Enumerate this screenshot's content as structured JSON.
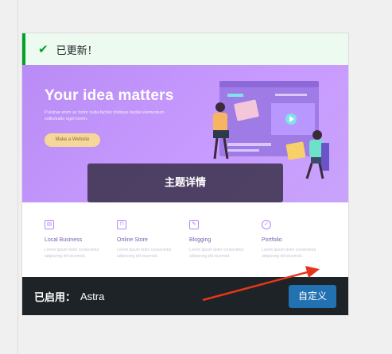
{
  "notice": {
    "icon": "checkmark-icon",
    "message": "已更新！",
    "accent": "#00a32a"
  },
  "theme_preview": {
    "hero_title": "Your idea matters",
    "hero_text": "Pulvinar enim ac tortor nulla facilisi tristique facilisi elementum sollicitudin eget lorem.",
    "hero_button": "Make a Website",
    "features": [
      {
        "icon": "building-icon",
        "title": "Local Business",
        "desc": "Lorem ipsum dolor consectetur adipiscing elit eiusmod."
      },
      {
        "icon": "bag-icon",
        "title": "Online Store",
        "desc": "Lorem ipsum dolor consectetur adipiscing elit eiusmod."
      },
      {
        "icon": "pencil-icon",
        "title": "Blogging",
        "desc": "Lorem ipsum dolor consectetur adipiscing elit eiusmod."
      },
      {
        "icon": "badge-icon",
        "title": "Portfolio",
        "desc": "Lorem ipsum dolor consectetur adipiscing elit eiusmod."
      }
    ]
  },
  "overlay": {
    "details_label": "主题详情"
  },
  "footer": {
    "active_label": "已启用：",
    "theme_name": "Astra",
    "customize_label": "自定义"
  },
  "colors": {
    "footer_bg": "#1d2327",
    "primary": "#2271b1",
    "hero": "#c79bff",
    "annotation_arrow": "#e8341c"
  }
}
